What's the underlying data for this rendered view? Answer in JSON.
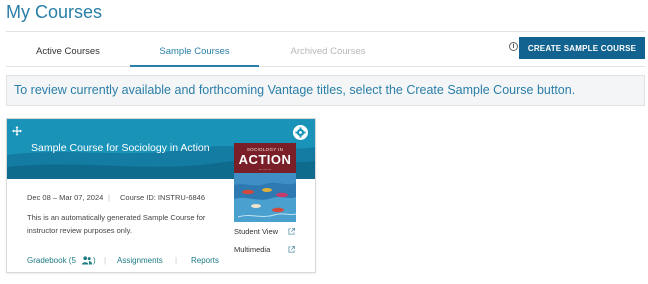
{
  "page": {
    "title": "My Courses"
  },
  "tabs": [
    {
      "label": "Active Courses",
      "state": "default"
    },
    {
      "label": "Sample Courses",
      "state": "selected"
    },
    {
      "label": "Archived Courses",
      "state": "disabled"
    }
  ],
  "toolbar": {
    "info_icon": "info-icon",
    "create_button_label": "CREATE SAMPLE COURSE"
  },
  "banner": {
    "text": "To review currently available and forthcoming Vantage titles, select the Create Sample Course button."
  },
  "course_card": {
    "title": "Sample Course for Sociology in Action",
    "dates": "Dec 08 – Mar 07, 2024",
    "separator": "|",
    "course_id": "Course ID: INSTRU-6846",
    "description": "This is an automatically generated Sample Course for instructor review purposes only.",
    "book_cover": {
      "small_text": "SOCIOLOGY IN",
      "title": "ACTION"
    },
    "links": {
      "student_view": "Student View",
      "multimedia": "Multimedia"
    },
    "footer": {
      "gradebook": "Gradebook (5",
      "gradebook_close": ")",
      "assignments": "Assignments",
      "reports": "Reports",
      "separator": "|"
    },
    "icons": {
      "move": "move-icon",
      "settings": "gear-icon",
      "external": "external-link-icon",
      "people": "people-icon"
    }
  },
  "colors": {
    "brand": "#2a7fa8",
    "button": "#12638f",
    "header": "#1a93b8",
    "link": "#1d7c84"
  }
}
